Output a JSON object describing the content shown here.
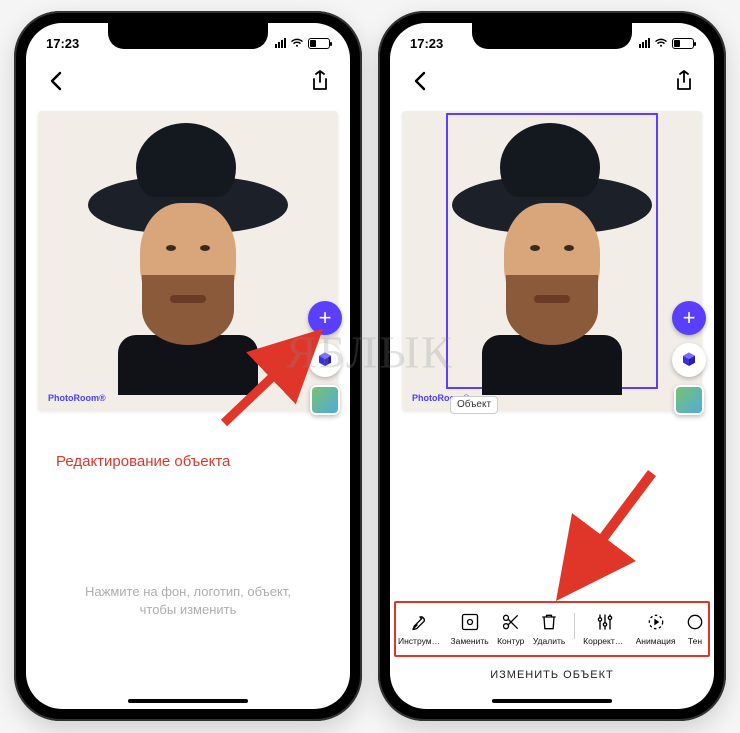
{
  "status": {
    "time": "17:23"
  },
  "left": {
    "brand": "PhotoRoom®",
    "annotation": "Редактирование объекта",
    "hint_line1": "Нажмите на фон, логотип, объект,",
    "hint_line2": "чтобы изменить"
  },
  "right": {
    "brand": "PhotoRoom®",
    "object_label": "Объект",
    "toolbar_title": "ИЗМЕНИТЬ ОБЪЕКТ",
    "tools": {
      "instruments": "Инструменты",
      "replace": "Заменить",
      "contour": "Контур",
      "delete": "Удалить",
      "adjust": "Корректирова…",
      "animation": "Анимация",
      "shadow": "Тен"
    }
  },
  "watermark": "ЯБЛЫК"
}
